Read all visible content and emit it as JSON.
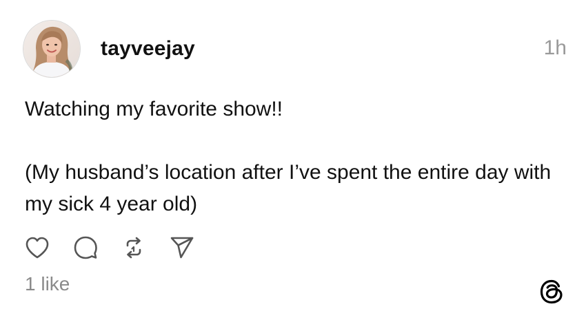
{
  "post": {
    "author": {
      "username": "tayveejay",
      "avatar_icon": "profile-photo"
    },
    "timestamp": "1h",
    "body": [
      "Watching my favorite show!!",
      "(My husband’s location after I’ve spent the entire day with my sick 4 year old)"
    ],
    "actions": [
      {
        "icon": "heart-icon",
        "label": "like"
      },
      {
        "icon": "comment-icon",
        "label": "reply"
      },
      {
        "icon": "repost-icon",
        "label": "repost"
      },
      {
        "icon": "share-icon",
        "label": "share"
      }
    ],
    "likes_text": "1 like",
    "brand_icon": "threads-logo-icon"
  },
  "colors": {
    "text": "#111111",
    "muted": "#9a9a9a",
    "icon": "#555555",
    "background": "#ffffff"
  }
}
